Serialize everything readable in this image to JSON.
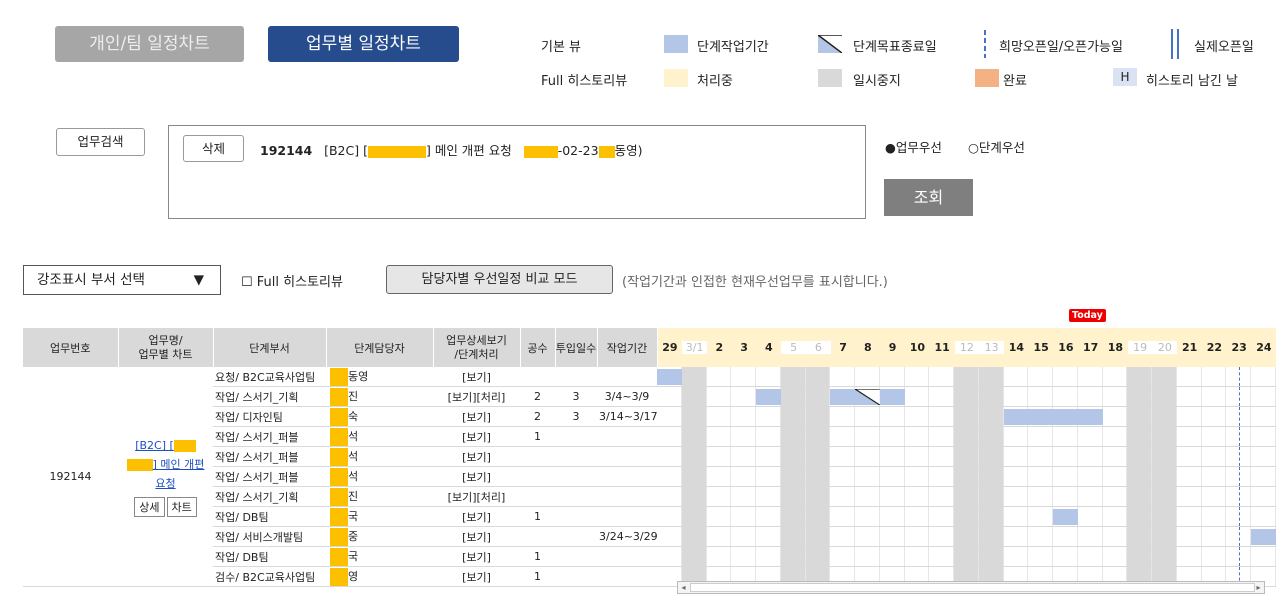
{
  "tabs": {
    "personal": "개인/팀 일정차트",
    "task": "업무별 일정차트"
  },
  "legend": {
    "basic_view": "기본 뷰",
    "full_history_view": "Full 히스토리뷰",
    "stage_work_period": "단계작업기간",
    "stage_goal_end": "단계목표종료일",
    "desired_open": "희망오픈일/오픈가능일",
    "actual_open": "실제오픈일",
    "processing": "처리중",
    "paused": "일시중지",
    "completed": "완료",
    "history_marker": "H",
    "history_left_day": "히스토리 남긴 날",
    "colors": {
      "work": "#b4c6e7",
      "processing": "#fff2cc",
      "paused": "#d9d9d9",
      "completed": "#f4b183",
      "weekend": "#d9d9d9"
    }
  },
  "search": {
    "button": "업무검색",
    "delete_button": "삭제",
    "task_no": "192144",
    "task_text_prefix": "[B2C] [",
    "task_text_mid": "] 메인 개편 요청",
    "task_text_date": "-02-23",
    "task_text_suffix": "동영)",
    "priority_task": "●업무우선",
    "priority_stage": "○단계우선",
    "query_button": "조회"
  },
  "controls": {
    "dept_select": "강조표시 부서 선택",
    "dept_arrow": "▼",
    "full_history_checkbox": "☐ Full 히스토리뷰",
    "compare_button": "담당자별 우선일정 비교 모드",
    "compare_note": "(작업기간과 인접한 현재우선업무를 표시합니다.)"
  },
  "table": {
    "headers": {
      "task_no": "업무번호",
      "task_name": "업무명/\n업무별 차트",
      "stage_dept": "단계부서",
      "stage_owner": "단계담당자",
      "detail": "업무상세보기\n/단계처리",
      "effort": "공수",
      "input_days": "투입일수",
      "work_period": "작업기간"
    },
    "days": [
      "29",
      "3/1",
      "2",
      "3",
      "4",
      "5",
      "6",
      "7",
      "8",
      "9",
      "10",
      "11",
      "12",
      "13",
      "14",
      "15",
      "16",
      "17",
      "18",
      "19",
      "20",
      "21",
      "22",
      "23",
      "24"
    ],
    "weekend_days": [
      1,
      5,
      6,
      12,
      13,
      19,
      20
    ],
    "today_label": "Today",
    "task_number": "192144",
    "task_link_1": "[B2C] [",
    "task_link_2": "] 메인 개편",
    "task_link_3": "요청",
    "detail_button": "상세",
    "chart_button": "차트",
    "rows": [
      {
        "dept": "요청/ B2C교육사업팀",
        "owner": "동영",
        "detail": "[보기]",
        "effort": "",
        "days": "",
        "period": ""
      },
      {
        "dept": "작업/ 스서기_기획",
        "owner": "진",
        "detail": "[보기][처리]",
        "effort": "2",
        "days": "3",
        "period": "3/4~3/9"
      },
      {
        "dept": "작업/ 디자인팀",
        "owner": "숙",
        "detail": "[보기]",
        "effort": "2",
        "days": "3",
        "period": "3/14~3/17"
      },
      {
        "dept": "작업/ 스서기_퍼블",
        "owner": "석",
        "detail": "[보기]",
        "effort": "1",
        "days": "",
        "period": ""
      },
      {
        "dept": "작업/ 스서기_퍼블",
        "owner": "석",
        "detail": "[보기]",
        "effort": "",
        "days": "",
        "period": ""
      },
      {
        "dept": "작업/ 스서기_퍼블",
        "owner": "석",
        "detail": "[보기]",
        "effort": "",
        "days": "",
        "period": ""
      },
      {
        "dept": "작업/ 스서기_기획",
        "owner": "진",
        "detail": "[보기][처리]",
        "effort": "",
        "days": "",
        "period": ""
      },
      {
        "dept": "작업/ DB팀",
        "owner": "국",
        "detail": "[보기]",
        "effort": "1",
        "days": "",
        "period": ""
      },
      {
        "dept": "작업/ 서비스개발팀",
        "owner": "중",
        "detail": "[보기]",
        "effort": "",
        "days": "",
        "period": "3/24~3/29"
      },
      {
        "dept": "작업/ DB팀",
        "owner": "국",
        "detail": "[보기]",
        "effort": "1",
        "days": "",
        "period": ""
      },
      {
        "dept": "검수/ B2C교육사업팀",
        "owner": "영",
        "detail": "[보기]",
        "effort": "1",
        "days": "",
        "period": ""
      }
    ]
  }
}
